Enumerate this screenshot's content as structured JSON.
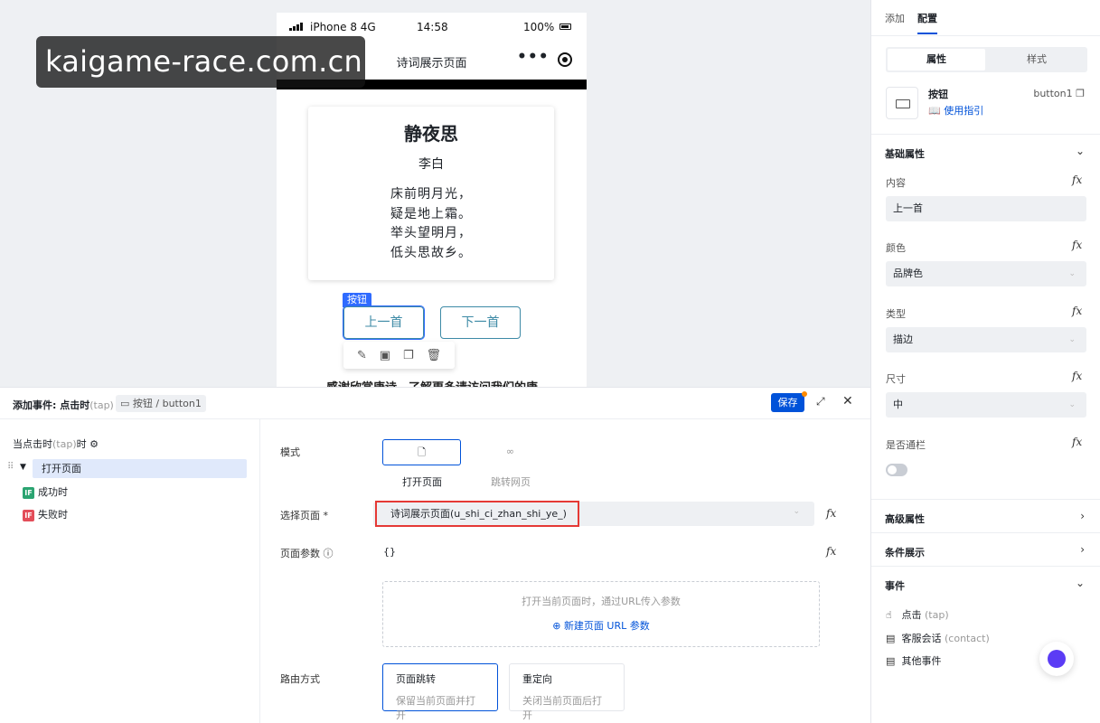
{
  "watermark": "kaigame-race.com.cn",
  "phone": {
    "carrier": "iPhone 8  4G",
    "time": "14:58",
    "battery": "100%",
    "nav_title": "诗词展示页面",
    "nav_more": "•••",
    "poem": {
      "title": "静夜思",
      "author": "李白",
      "lines": [
        "床前明月光，",
        "疑是地上霜。",
        "举头望明月，",
        "低头思故乡。"
      ]
    },
    "selected_label": "按钮",
    "prev_button": "上一首",
    "next_button": "下一首",
    "toolbar_icons": [
      "edit-icon",
      "save-icon",
      "copy-icon",
      "delete-icon"
    ],
    "bottom_text": "感谢欣赏唐诗，了解更多请访问我们的唐"
  },
  "right_panel": {
    "tabs": [
      "添加",
      "配置"
    ],
    "active_tab": "配置",
    "segments": [
      "属性",
      "样式"
    ],
    "component": {
      "name": "按钮",
      "id": "button1",
      "guide": "使用指引"
    },
    "basic_section": "基础属性",
    "props": [
      {
        "label": "内容",
        "value": "上一首"
      },
      {
        "label": "颜色",
        "value": "品牌色"
      },
      {
        "label": "类型",
        "value": "描边"
      },
      {
        "label": "尺寸",
        "value": "中"
      },
      {
        "label": "是否通栏",
        "value": ""
      }
    ],
    "fx_label": "fx",
    "advanced_section": "高级属性",
    "condition_section": "条件展示",
    "events_section": "事件",
    "events": [
      {
        "label": "点击",
        "sub": "(tap)"
      },
      {
        "label": "客服会话",
        "sub": "(contact)"
      },
      {
        "label": "其他事件",
        "sub": ""
      }
    ]
  },
  "event_panel": {
    "title": "添加事件: 点击时",
    "title_sub": "(tap)",
    "tag": "按钮 / button1",
    "save": "保存",
    "trigger": "当点击时",
    "trigger_sub": "(tap)",
    "trigger_suffix": "时",
    "action": "打开页面",
    "success": "成功时",
    "fail": "失败时",
    "if_badge": "IF",
    "form": {
      "mode_label": "模式",
      "mode_open": "打开页面",
      "mode_jump": "跳转网页",
      "page_label": "选择页面 *",
      "page_value": "诗词展示页面(u_shi_ci_zhan_shi_ye_)",
      "params_label": "页面参数",
      "params_value": "{}",
      "params_hint": "打开当前页面时，通过URL传入参数",
      "params_add": "新建页面 URL 参数",
      "route_label": "路由方式",
      "route_nav": "页面跳转",
      "route_nav_desc": "保留当前页面并打开",
      "route_redirect": "重定向",
      "route_redirect_desc": "关闭当前页面后打开"
    }
  }
}
